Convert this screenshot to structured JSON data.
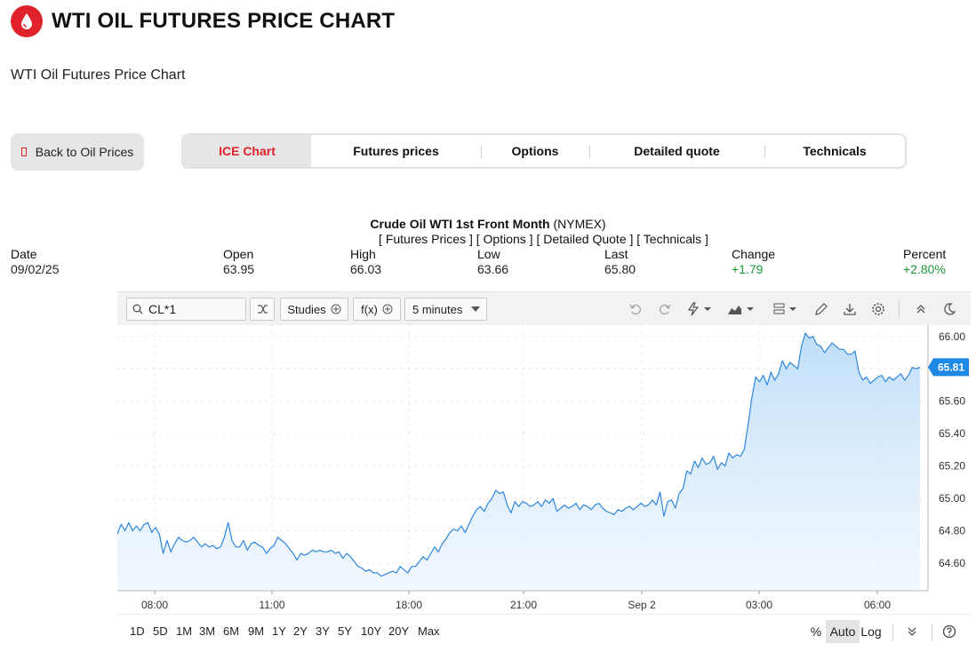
{
  "header": {
    "title": "WTI OIL FUTURES PRICE CHART",
    "logo_icon": "oil-drop-icon",
    "brand_color": "#e0232b"
  },
  "subtitle": "WTI Oil Futures Price Chart",
  "back_button": {
    "label": "Back to Oil Prices"
  },
  "tabs": [
    {
      "label": "ICE Chart",
      "active": true
    },
    {
      "label": "Futures prices"
    },
    {
      "label": "Options"
    },
    {
      "label": "Detailed quote"
    },
    {
      "label": "Technicals"
    }
  ],
  "chart_heading": {
    "name": "Crude Oil WTI 1st Front Month",
    "exchange": "(NYMEX)",
    "links": "[ Futures Prices ] [ Options ] [ Detailed Quote ] [ Technicals ]"
  },
  "quote": {
    "date": {
      "label": "Date",
      "value": "09/02/25"
    },
    "open": {
      "label": "Open",
      "value": "63.95"
    },
    "high": {
      "label": "High",
      "value": "66.03"
    },
    "low": {
      "label": "Low",
      "value": "63.66"
    },
    "last": {
      "label": "Last",
      "value": "65.80"
    },
    "change": {
      "label": "Change",
      "value": "+1.79"
    },
    "percent": {
      "label": "Percent",
      "value": "+2.80%"
    }
  },
  "toolbar": {
    "symbol": "CL*1",
    "studies_label": "Studies",
    "fx_label": "f(x)",
    "interval_label": "5 minutes",
    "icons": [
      "search-icon",
      "compare-icon",
      "undo-icon",
      "redo-icon",
      "lightning-icon",
      "chart-type-icon",
      "template-icon",
      "pencil-icon",
      "download-icon",
      "gear-icon",
      "collapse-icon",
      "dark-mode-icon"
    ]
  },
  "chart_data": {
    "type": "area",
    "x_ticks": [
      "08:00",
      "11:00",
      "18:00",
      "21:00",
      "Sep 2",
      "03:00",
      "06:00"
    ],
    "y_ticks": [
      "66.00",
      "65.80",
      "65.60",
      "65.40",
      "65.20",
      "65.00",
      "64.80",
      "64.60"
    ],
    "ylim": [
      64.43,
      66.07
    ],
    "last_value_label": "65.81",
    "line_color": "#2e86de",
    "values": [
      64.78,
      64.84,
      64.8,
      64.85,
      64.8,
      64.83,
      64.8,
      64.84,
      64.85,
      64.79,
      64.82,
      64.78,
      64.66,
      64.74,
      64.67,
      64.72,
      64.76,
      64.74,
      64.73,
      64.74,
      64.76,
      64.73,
      64.7,
      64.72,
      64.7,
      64.71,
      64.69,
      64.7,
      64.76,
      64.85,
      64.74,
      64.7,
      64.7,
      64.74,
      64.68,
      64.72,
      64.73,
      64.71,
      64.7,
      64.66,
      64.69,
      64.71,
      64.76,
      64.74,
      64.72,
      64.69,
      64.66,
      64.62,
      64.66,
      64.65,
      64.66,
      64.68,
      64.67,
      64.68,
      64.67,
      64.67,
      64.68,
      64.66,
      64.67,
      64.63,
      64.66,
      64.64,
      64.61,
      64.58,
      64.57,
      64.55,
      64.56,
      64.54,
      64.54,
      64.52,
      64.53,
      64.54,
      64.55,
      64.54,
      64.58,
      64.56,
      64.54,
      64.58,
      64.58,
      64.61,
      64.64,
      64.62,
      64.66,
      64.7,
      64.67,
      64.72,
      64.75,
      64.79,
      64.81,
      64.8,
      64.83,
      64.79,
      64.84,
      64.89,
      64.93,
      64.95,
      64.92,
      64.97,
      65.0,
      65.05,
      65.03,
      65.04,
      64.96,
      64.91,
      64.98,
      64.95,
      64.98,
      64.97,
      64.95,
      64.96,
      64.98,
      64.95,
      64.99,
      64.97,
      65.0,
      64.92,
      64.94,
      64.96,
      64.94,
      64.95,
      64.97,
      64.93,
      64.96,
      64.95,
      64.93,
      64.96,
      64.97,
      64.94,
      64.92,
      64.91,
      64.9,
      64.93,
      64.92,
      64.94,
      64.95,
      64.93,
      64.95,
      64.97,
      64.95,
      64.96,
      64.99,
      64.96,
      65.04,
      64.89,
      64.98,
      64.99,
      64.94,
      65.03,
      65.06,
      65.17,
      65.15,
      65.23,
      65.19,
      65.25,
      65.21,
      65.22,
      65.26,
      65.18,
      65.22,
      65.2,
      65.28,
      65.25,
      65.27,
      65.26,
      65.3,
      65.45,
      65.62,
      65.75,
      65.72,
      65.76,
      65.7,
      65.78,
      65.73,
      65.77,
      65.85,
      65.8,
      65.84,
      65.82,
      65.8,
      65.94,
      66.02,
      65.99,
      66.0,
      65.95,
      65.94,
      65.9,
      65.93,
      65.96,
      65.94,
      65.92,
      65.92,
      65.89,
      65.89,
      65.91,
      65.78,
      65.73,
      65.75,
      65.71,
      65.73,
      65.75,
      65.76,
      65.72,
      65.75,
      65.73,
      65.75,
      65.77,
      65.73,
      65.76,
      65.81,
      65.8,
      65.81
    ]
  },
  "time_ranges": [
    "1D",
    "5D",
    "1M",
    "3M",
    "6M",
    "9M",
    "1Y",
    "2Y",
    "3Y",
    "5Y",
    "10Y",
    "20Y",
    "Max"
  ],
  "scale": {
    "percent": "%",
    "auto": "Auto",
    "log": "Log"
  }
}
